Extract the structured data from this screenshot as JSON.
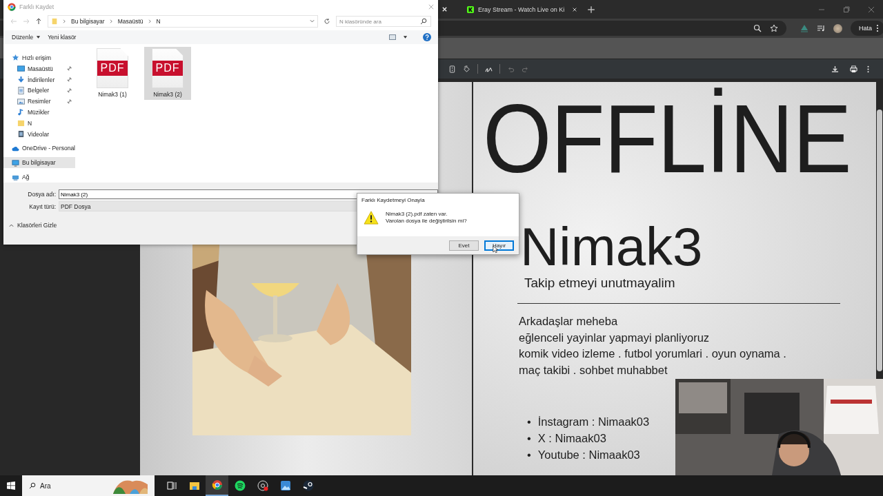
{
  "browser": {
    "tabs": [
      {
        "title": "Eray Stream - Watch Live on Ki",
        "selected": false
      }
    ],
    "profile_button": "Hata"
  },
  "document": {
    "heading": "OFFLİNE",
    "name": "Nimak3",
    "tagline": "Takip etmeyi unutmayalim",
    "paragraph": [
      "Arkadaşlar meheba",
      "eğlenceli yayinlar yapmayi planliyoruz",
      "komik video izleme . futbol yorumlari . oyun oynama .",
      "maç takibi . sohbet muhabbet"
    ],
    "socials": [
      {
        "marker": "•",
        "text": "İnstagram : Nimaak03"
      },
      {
        "marker": "•",
        "text": "X : Nimaak03"
      },
      {
        "marker": "•",
        "text": "Youtube : Nimaak03"
      }
    ]
  },
  "save_dialog": {
    "title": "Farklı Kaydet",
    "breadcrumb": [
      "Bu bilgisayar",
      "Masaüstü",
      "N"
    ],
    "search": {
      "placeholder": "N klasöründe ara"
    },
    "toolbar": [
      "Düzenle",
      "Yeni klasör"
    ],
    "sidebar": [
      {
        "label": "Hızlı erişim",
        "kind": "star",
        "selected": false,
        "children": [
          {
            "label": "Masaüstü",
            "kind": "desktop",
            "pinned": true,
            "selected": false
          },
          {
            "label": "İndirilenler",
            "kind": "download",
            "pinned": true,
            "selected": false
          },
          {
            "label": "Belgeler",
            "kind": "docs",
            "pinned": true,
            "selected": false
          },
          {
            "label": "Resimler",
            "kind": "pictures",
            "pinned": true,
            "selected": false
          },
          {
            "label": "Müzikler",
            "kind": "music",
            "pinned": false,
            "selected": false
          },
          {
            "label": "N",
            "kind": "folder",
            "pinned": false,
            "selected": false
          },
          {
            "label": "Videolar",
            "kind": "video",
            "pinned": false,
            "selected": false
          }
        ]
      },
      {
        "label": "OneDrive - Personal",
        "kind": "cloud",
        "selected": false
      },
      {
        "label": "Bu bilgisayar",
        "kind": "pc",
        "selected": true
      },
      {
        "label": "Ağ",
        "kind": "network",
        "selected": false
      }
    ],
    "files": [
      {
        "name": "Nimak3 (1)",
        "badge": "PDF",
        "selected": false
      },
      {
        "name": "Nimak3 (2)",
        "badge": "PDF",
        "selected": true
      }
    ],
    "file_name": {
      "label": "Dosya adı:",
      "value": "Nimak3 (2)"
    },
    "file_type": {
      "label": "Kayıt türü:",
      "value": "PDF Dosya"
    },
    "hide_folders": "Klasörleri Gizle"
  },
  "confirm_dialog": {
    "title": "Farklı Kaydetmeyi Onayla",
    "message": [
      "Nimak3 (2).pdf zaten var.",
      "Varolan dosya ile değiştirilsin mi?"
    ],
    "buttons": [
      {
        "label": "Evet",
        "selected": false
      },
      {
        "label": "Hayır",
        "selected": true
      }
    ]
  },
  "taskbar": {
    "search": {
      "placeholder": "Ara"
    },
    "apps": [
      {
        "kind": "taskview",
        "selected": false
      },
      {
        "kind": "explorer",
        "selected": false
      },
      {
        "kind": "chrome",
        "selected": true
      },
      {
        "kind": "spotify",
        "selected": false
      },
      {
        "kind": "recorder",
        "selected": false
      },
      {
        "kind": "photos",
        "selected": false
      },
      {
        "kind": "steam",
        "selected": false
      }
    ]
  }
}
